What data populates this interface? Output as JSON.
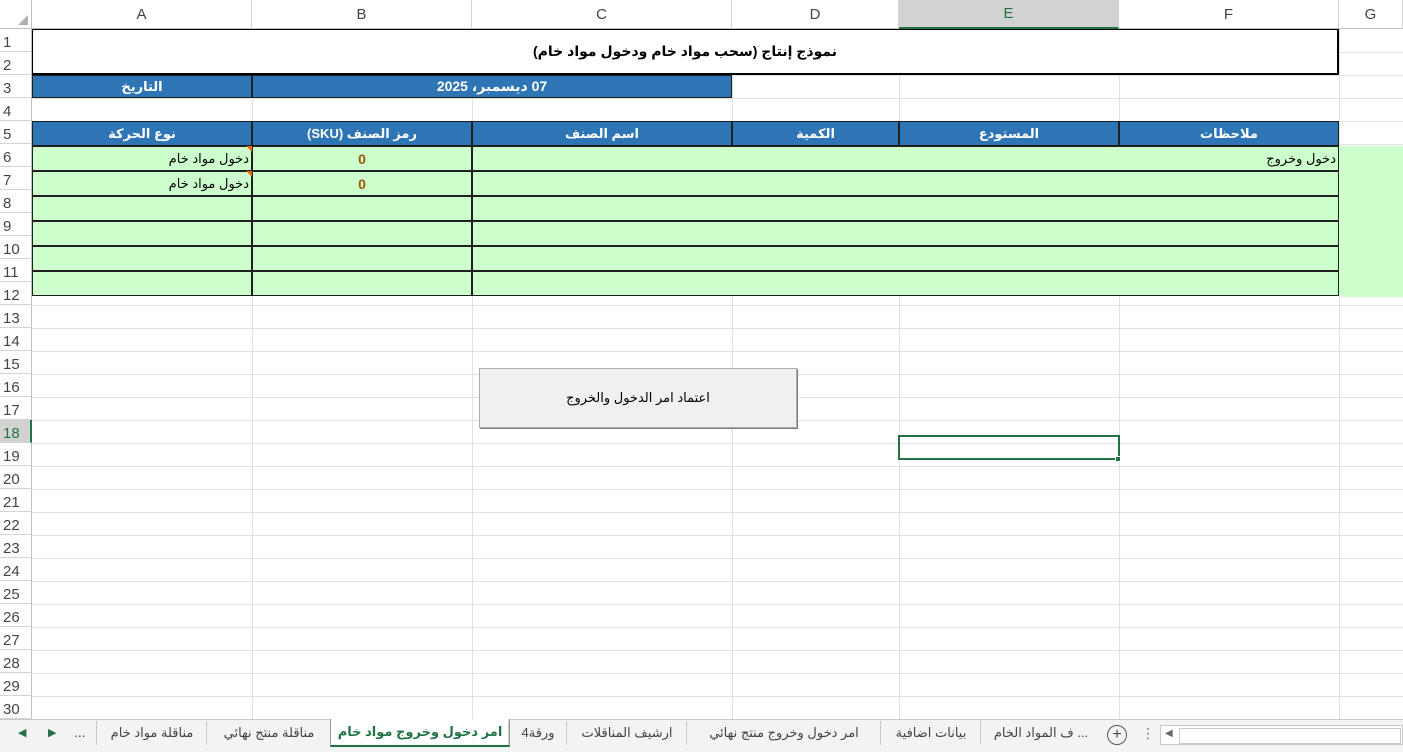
{
  "sheet": {
    "columns": [
      "A",
      "B",
      "C",
      "D",
      "E",
      "F",
      "G"
    ],
    "rows": [
      "1",
      "2",
      "3",
      "4",
      "5",
      "6",
      "7",
      "8",
      "9",
      "10",
      "11",
      "12",
      "13",
      "14",
      "15",
      "16",
      "17",
      "18",
      "19",
      "20",
      "21",
      "22",
      "23",
      "24",
      "25",
      "26",
      "27",
      "28",
      "29",
      "30"
    ],
    "selected_row": "18",
    "selected_col": "E"
  },
  "form": {
    "title": "نموذج إنتاج (سحب مواد خام ودخول  مواد خام)",
    "date_label": "التاريخ",
    "date_value": "07 ديسمبر، 2025",
    "headers": {
      "movement_type": "نوع الحركة",
      "sku": "رمز الصنف (SKU)",
      "item_name": "اسم الصنف",
      "quantity": "الكمية",
      "warehouse": "المستودع",
      "notes": "ملاحظات"
    },
    "rows": [
      {
        "movement_type": "دخول مواد خام",
        "sku": "0",
        "notes": "دخول وخروج"
      },
      {
        "movement_type": "دخول مواد خام",
        "sku": "0",
        "notes": ""
      },
      {
        "movement_type": "",
        "sku": "",
        "notes": ""
      },
      {
        "movement_type": "",
        "sku": "",
        "notes": ""
      },
      {
        "movement_type": "",
        "sku": "",
        "notes": ""
      },
      {
        "movement_type": "",
        "sku": "",
        "notes": ""
      }
    ],
    "approve_button": "اعتماد امر الدخول والخروج"
  },
  "tabs": {
    "items": [
      "مناقلة مواد خام",
      "مناقلة منتج نهائي",
      "امر دخول وخروج مواد خام",
      "ورقة4",
      "ارشيف المناقلات",
      "امر دخول وخروج منتج نهائي",
      "بيانات اضافية",
      "... ف المواد الخام"
    ],
    "active_index": 2,
    "more": "...",
    "add_icon": "plus-icon"
  },
  "colors": {
    "header_blue": "#2e75b6",
    "row_green": "#ccffcc",
    "excel_green": "#217346",
    "sku_text": "#9c5700"
  }
}
